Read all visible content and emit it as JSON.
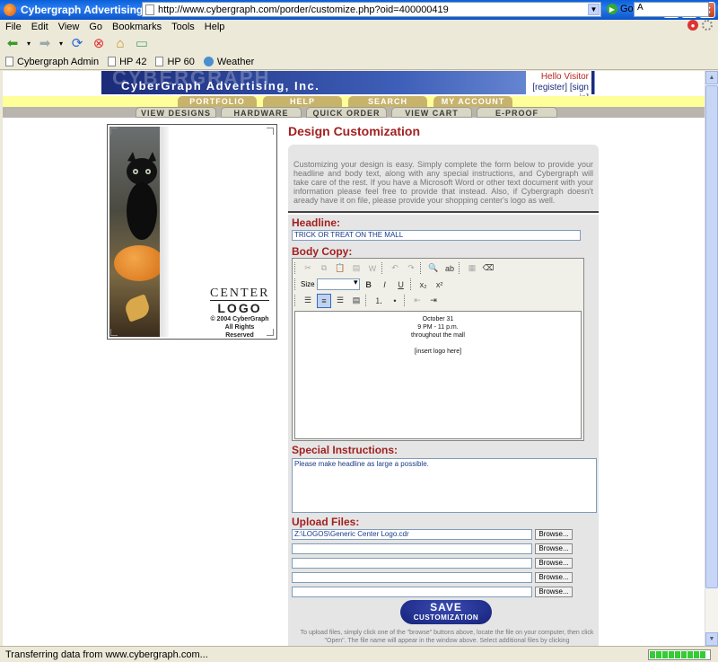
{
  "window": {
    "title": "Cybergraph Advertising, Inc. - mallsigns.com - Mozilla Firefox"
  },
  "menu": [
    "File",
    "Edit",
    "View",
    "Go",
    "Bookmarks",
    "Tools",
    "Help"
  ],
  "nav": {
    "url": "http://www.cybergraph.com/porder/customize.php?oid=400000419",
    "go_label": "Go",
    "search_value": "A"
  },
  "bookmarks": [
    "Cybergraph Admin",
    "HP 42",
    "HP 60",
    "Weather"
  ],
  "site": {
    "brand": "CyberGraph Advertising, Inc.",
    "brand_mark": "CYBERGRAPH",
    "hello": "Hello Visitor",
    "register": "[register]",
    "signin": "[sign in]",
    "nav_top": [
      "PORTFOLIO",
      "HELP",
      "SEARCH",
      "MY ACCOUNT"
    ],
    "nav_bottom": [
      "VIEW DESIGNS",
      "HARDWARE",
      "QUICK ORDER",
      "VIEW CART",
      "E-PROOF"
    ]
  },
  "preview": {
    "logo_line1": "CENTER",
    "logo_line2": "LOGO",
    "copyright": "© 2004 CyberGraph",
    "rights": "All Rights Reserved"
  },
  "form": {
    "title": "Design Customization",
    "intro": "Customizing your design is easy. Simply complete the form below to provide your headline and body text, along with any special instructions, and Cybergraph will take care of the rest. If you have a Microsoft Word or other text document with your information please feel free to provide that instead. Also, if Cybergraph doesn't aready have it on file, please provide your shopping center's logo as well.",
    "headline_label": "Headline:",
    "headline_value": "TRICK OR TREAT ON THE MALL",
    "body_label": "Body Copy:",
    "size_label": "Size",
    "body_lines": [
      "October 31",
      "9 PM - 11 p.m.",
      "throughout the mall",
      "",
      "[insert logo here]"
    ],
    "special_label": "Special Instructions:",
    "special_value": "Please make headline as large a possible.",
    "upload_label": "Upload Files:",
    "upload_files": [
      "Z:\\LOGOS\\Generic Center Logo.cdr",
      "",
      "",
      "",
      ""
    ],
    "browse_label": "Browse...",
    "save_line1": "SAVE",
    "save_line2": "CUSTOMIZATION",
    "upload_help": "To upload files, simply click one of the \"browse\" buttons above, locate the file on your computer, then click \"Open\". The file name will appear in the window above. Select additional files by clicking"
  },
  "status": {
    "text": "Transferring data from www.cybergraph.com..."
  },
  "colors": {
    "accent": "#a32020",
    "brand": "#1b2b7a",
    "nav_gold": "#c8b36a"
  }
}
